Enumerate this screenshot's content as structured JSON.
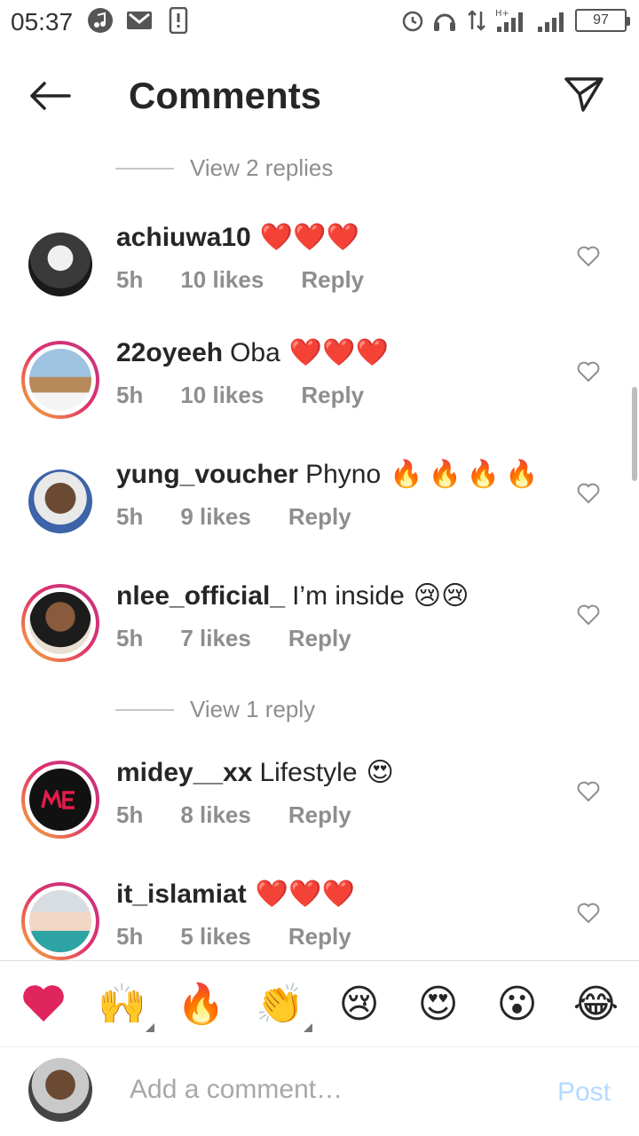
{
  "status": {
    "time": "05:37",
    "network": "H+",
    "battery": "97"
  },
  "header": {
    "title": "Comments"
  },
  "view_replies": [
    {
      "label": "View 2 replies"
    },
    {
      "label": "View 1 reply"
    }
  ],
  "comments": [
    {
      "user": "achiuwa10",
      "text": "",
      "emoji": "❤️❤️❤️",
      "time": "5h",
      "likes": "10 likes",
      "reply": "Reply",
      "story": false
    },
    {
      "user": "22oyeeh",
      "text": "Oba",
      "emoji": "❤️❤️❤️",
      "time": "5h",
      "likes": "10 likes",
      "reply": "Reply",
      "story": true
    },
    {
      "user": "yung_voucher",
      "text": "Phyno",
      "emoji": "🔥🔥🔥🔥",
      "time": "5h",
      "likes": "9 likes",
      "reply": "Reply",
      "story": false
    },
    {
      "user": "nlee_official_",
      "text": "I’m inside",
      "emoji": "😢😢",
      "time": "5h",
      "likes": "7 likes",
      "reply": "Reply",
      "story": true
    },
    {
      "user": "midey__xx",
      "text": "Lifestyle",
      "emoji": "😍",
      "time": "5h",
      "likes": "8 likes",
      "reply": "Reply",
      "story": true
    },
    {
      "user": "it_islamiat",
      "text": "",
      "emoji": "❤️❤️❤️",
      "time": "5h",
      "likes": "5 likes",
      "reply": "Reply",
      "story": true
    }
  ],
  "emoji_bar": [
    "❤️",
    "🙌",
    "🔥",
    "👏",
    "😢",
    "😍",
    "😮",
    "😂"
  ],
  "composer": {
    "placeholder": "Add a comment…",
    "post_label": "Post"
  },
  "icons": {
    "back": "arrow-left-icon",
    "send": "paper-plane-icon",
    "like": "heart-outline-icon"
  },
  "colors": {
    "post_disabled": "#b3dbff",
    "meta_gray": "#8e8e8e",
    "story_ring": "#e1306c"
  }
}
